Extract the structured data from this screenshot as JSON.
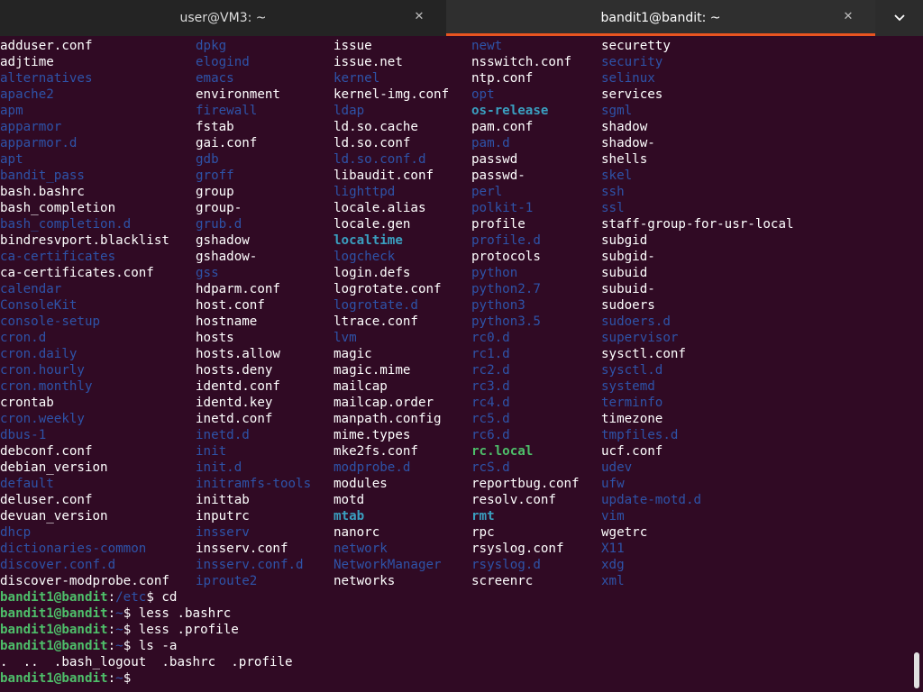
{
  "tabs": [
    {
      "title": "user@VM3: ~",
      "active": false
    },
    {
      "title": "bandit1@bandit: ~",
      "active": true
    }
  ],
  "colors": {
    "background": "#300a24",
    "directory": "#2e53a8",
    "link": "#3a9fc0",
    "exec": "#4ebf6a",
    "accent": "#e95420"
  },
  "listing": [
    [
      [
        "adduser.conf",
        "f"
      ],
      [
        "adjtime",
        "f"
      ],
      [
        "alternatives",
        "d"
      ],
      [
        "apache2",
        "d"
      ],
      [
        "apm",
        "d"
      ],
      [
        "apparmor",
        "d"
      ],
      [
        "apparmor.d",
        "d"
      ],
      [
        "apt",
        "d"
      ],
      [
        "bandit_pass",
        "d"
      ],
      [
        "bash.bashrc",
        "f"
      ],
      [
        "bash_completion",
        "f"
      ],
      [
        "bash_completion.d",
        "d"
      ],
      [
        "bindresvport.blacklist",
        "f"
      ],
      [
        "ca-certificates",
        "d"
      ],
      [
        "ca-certificates.conf",
        "f"
      ],
      [
        "calendar",
        "d"
      ],
      [
        "ConsoleKit",
        "d"
      ],
      [
        "console-setup",
        "d"
      ],
      [
        "cron.d",
        "d"
      ],
      [
        "cron.daily",
        "d"
      ],
      [
        "cron.hourly",
        "d"
      ],
      [
        "cron.monthly",
        "d"
      ],
      [
        "crontab",
        "f"
      ],
      [
        "cron.weekly",
        "d"
      ],
      [
        "dbus-1",
        "d"
      ],
      [
        "debconf.conf",
        "f"
      ],
      [
        "debian_version",
        "f"
      ],
      [
        "default",
        "d"
      ],
      [
        "deluser.conf",
        "f"
      ],
      [
        "devuan_version",
        "f"
      ],
      [
        "dhcp",
        "d"
      ],
      [
        "dictionaries-common",
        "d"
      ],
      [
        "discover.conf.d",
        "d"
      ],
      [
        "discover-modprobe.conf",
        "f"
      ]
    ],
    [
      [
        "dpkg",
        "d"
      ],
      [
        "elogind",
        "d"
      ],
      [
        "emacs",
        "d"
      ],
      [
        "environment",
        "f"
      ],
      [
        "firewall",
        "d"
      ],
      [
        "fstab",
        "f"
      ],
      [
        "gai.conf",
        "f"
      ],
      [
        "gdb",
        "d"
      ],
      [
        "groff",
        "d"
      ],
      [
        "group",
        "f"
      ],
      [
        "group-",
        "f"
      ],
      [
        "grub.d",
        "d"
      ],
      [
        "gshadow",
        "f"
      ],
      [
        "gshadow-",
        "f"
      ],
      [
        "gss",
        "d"
      ],
      [
        "hdparm.conf",
        "f"
      ],
      [
        "host.conf",
        "f"
      ],
      [
        "hostname",
        "f"
      ],
      [
        "hosts",
        "f"
      ],
      [
        "hosts.allow",
        "f"
      ],
      [
        "hosts.deny",
        "f"
      ],
      [
        "identd.conf",
        "f"
      ],
      [
        "identd.key",
        "f"
      ],
      [
        "inetd.conf",
        "f"
      ],
      [
        "inetd.d",
        "d"
      ],
      [
        "init",
        "d"
      ],
      [
        "init.d",
        "d"
      ],
      [
        "initramfs-tools",
        "d"
      ],
      [
        "inittab",
        "f"
      ],
      [
        "inputrc",
        "f"
      ],
      [
        "insserv",
        "d"
      ],
      [
        "insserv.conf",
        "f"
      ],
      [
        "insserv.conf.d",
        "d"
      ],
      [
        "iproute2",
        "d"
      ]
    ],
    [
      [
        "issue",
        "f"
      ],
      [
        "issue.net",
        "f"
      ],
      [
        "kernel",
        "d"
      ],
      [
        "kernel-img.conf",
        "f"
      ],
      [
        "ldap",
        "d"
      ],
      [
        "ld.so.cache",
        "f"
      ],
      [
        "ld.so.conf",
        "f"
      ],
      [
        "ld.so.conf.d",
        "d"
      ],
      [
        "libaudit.conf",
        "f"
      ],
      [
        "lighttpd",
        "d"
      ],
      [
        "locale.alias",
        "f"
      ],
      [
        "locale.gen",
        "f"
      ],
      [
        "localtime",
        "l"
      ],
      [
        "logcheck",
        "d"
      ],
      [
        "login.defs",
        "f"
      ],
      [
        "logrotate.conf",
        "f"
      ],
      [
        "logrotate.d",
        "d"
      ],
      [
        "ltrace.conf",
        "f"
      ],
      [
        "lvm",
        "d"
      ],
      [
        "magic",
        "f"
      ],
      [
        "magic.mime",
        "f"
      ],
      [
        "mailcap",
        "f"
      ],
      [
        "mailcap.order",
        "f"
      ],
      [
        "manpath.config",
        "f"
      ],
      [
        "mime.types",
        "f"
      ],
      [
        "mke2fs.conf",
        "f"
      ],
      [
        "modprobe.d",
        "d"
      ],
      [
        "modules",
        "f"
      ],
      [
        "motd",
        "f"
      ],
      [
        "mtab",
        "l"
      ],
      [
        "nanorc",
        "f"
      ],
      [
        "network",
        "d"
      ],
      [
        "NetworkManager",
        "d"
      ],
      [
        "networks",
        "f"
      ]
    ],
    [
      [
        "newt",
        "d"
      ],
      [
        "nsswitch.conf",
        "f"
      ],
      [
        "ntp.conf",
        "f"
      ],
      [
        "opt",
        "d"
      ],
      [
        "os-release",
        "l"
      ],
      [
        "pam.conf",
        "f"
      ],
      [
        "pam.d",
        "d"
      ],
      [
        "passwd",
        "f"
      ],
      [
        "passwd-",
        "f"
      ],
      [
        "perl",
        "d"
      ],
      [
        "polkit-1",
        "d"
      ],
      [
        "profile",
        "f"
      ],
      [
        "profile.d",
        "d"
      ],
      [
        "protocols",
        "f"
      ],
      [
        "python",
        "d"
      ],
      [
        "python2.7",
        "d"
      ],
      [
        "python3",
        "d"
      ],
      [
        "python3.5",
        "d"
      ],
      [
        "rc0.d",
        "d"
      ],
      [
        "rc1.d",
        "d"
      ],
      [
        "rc2.d",
        "d"
      ],
      [
        "rc3.d",
        "d"
      ],
      [
        "rc4.d",
        "d"
      ],
      [
        "rc5.d",
        "d"
      ],
      [
        "rc6.d",
        "d"
      ],
      [
        "rc.local",
        "x"
      ],
      [
        "rcS.d",
        "d"
      ],
      [
        "reportbug.conf",
        "f"
      ],
      [
        "resolv.conf",
        "f"
      ],
      [
        "rmt",
        "l"
      ],
      [
        "rpc",
        "f"
      ],
      [
        "rsyslog.conf",
        "f"
      ],
      [
        "rsyslog.d",
        "d"
      ],
      [
        "screenrc",
        "f"
      ]
    ],
    [
      [
        "securetty",
        "f"
      ],
      [
        "security",
        "d"
      ],
      [
        "selinux",
        "d"
      ],
      [
        "services",
        "f"
      ],
      [
        "sgml",
        "d"
      ],
      [
        "shadow",
        "f"
      ],
      [
        "shadow-",
        "f"
      ],
      [
        "shells",
        "f"
      ],
      [
        "skel",
        "d"
      ],
      [
        "ssh",
        "d"
      ],
      [
        "ssl",
        "d"
      ],
      [
        "staff-group-for-usr-local",
        "f"
      ],
      [
        "subgid",
        "f"
      ],
      [
        "subgid-",
        "f"
      ],
      [
        "subuid",
        "f"
      ],
      [
        "subuid-",
        "f"
      ],
      [
        "sudoers",
        "f"
      ],
      [
        "sudoers.d",
        "d"
      ],
      [
        "supervisor",
        "d"
      ],
      [
        "sysctl.conf",
        "f"
      ],
      [
        "sysctl.d",
        "d"
      ],
      [
        "systemd",
        "d"
      ],
      [
        "terminfo",
        "d"
      ],
      [
        "timezone",
        "f"
      ],
      [
        "tmpfiles.d",
        "d"
      ],
      [
        "ucf.conf",
        "f"
      ],
      [
        "udev",
        "d"
      ],
      [
        "ufw",
        "d"
      ],
      [
        "update-motd.d",
        "d"
      ],
      [
        "vim",
        "d"
      ],
      [
        "wgetrc",
        "f"
      ],
      [
        "X11",
        "d"
      ],
      [
        "xdg",
        "d"
      ],
      [
        "xml",
        "d"
      ]
    ]
  ],
  "history": [
    {
      "user": "bandit1@bandit",
      "path": "/etc",
      "command": "$ cd"
    },
    {
      "user": "bandit1@bandit",
      "path": "~",
      "command": "$ less .bashrc"
    },
    {
      "user": "bandit1@bandit",
      "path": "~",
      "command": "$ less .profile"
    },
    {
      "user": "bandit1@bandit",
      "path": "~",
      "command": "$ ls -a"
    },
    {
      "output": ".  ..  .bash_logout  .bashrc  .profile"
    },
    {
      "user": "bandit1@bandit",
      "path": "~",
      "command": "$ "
    }
  ]
}
